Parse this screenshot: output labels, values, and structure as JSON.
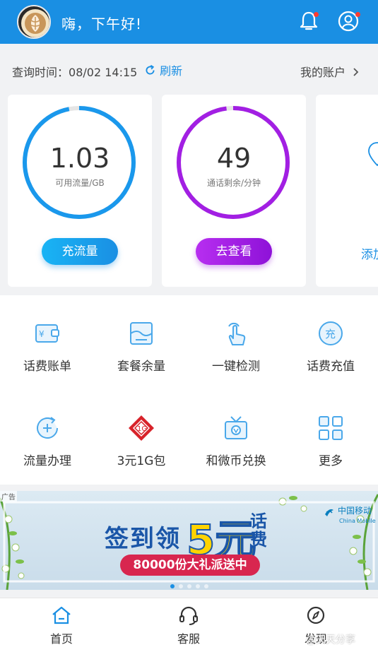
{
  "header": {
    "greeting": "嗨，下午好!"
  },
  "query": {
    "label": "查询时间：",
    "time": "08/02 14:15",
    "refresh": "刷新",
    "account": "我的账户"
  },
  "cards": [
    {
      "value": "1.03",
      "label": "可用流量/GB",
      "button": "充流量",
      "color": "#1a98ec",
      "progress": 0.97
    },
    {
      "value": "49",
      "label": "通话剩余/分钟",
      "button": "去查看",
      "color": "#a21fe3",
      "progress": 0.98
    },
    {
      "button": "添加"
    }
  ],
  "grid": [
    {
      "label": "话费账单",
      "icon": "bill-icon"
    },
    {
      "label": "套餐余量",
      "icon": "package-icon"
    },
    {
      "label": "一键检测",
      "icon": "touch-icon"
    },
    {
      "label": "话费充值",
      "icon": "recharge-icon"
    },
    {
      "label": "流量办理",
      "icon": "data-plus-icon"
    },
    {
      "label": "3元1G包",
      "icon": "gift-pack-icon"
    },
    {
      "label": "和微币兑换",
      "icon": "coin-exchange-icon"
    },
    {
      "label": "更多",
      "icon": "more-grid-icon"
    }
  ],
  "banner": {
    "ad_tag": "广告",
    "title": "签到领",
    "big": "5元",
    "fee": "话费",
    "strip": "80000份大礼派送中",
    "brand_cn": "中国移动",
    "brand_en": "China Mobile"
  },
  "tabs": [
    {
      "label": "首页",
      "icon": "home-icon",
      "active": true
    },
    {
      "label": "客服",
      "icon": "headset-icon"
    },
    {
      "label": "发现",
      "icon": "compass-icon"
    }
  ],
  "watermark": "@天天分享"
}
